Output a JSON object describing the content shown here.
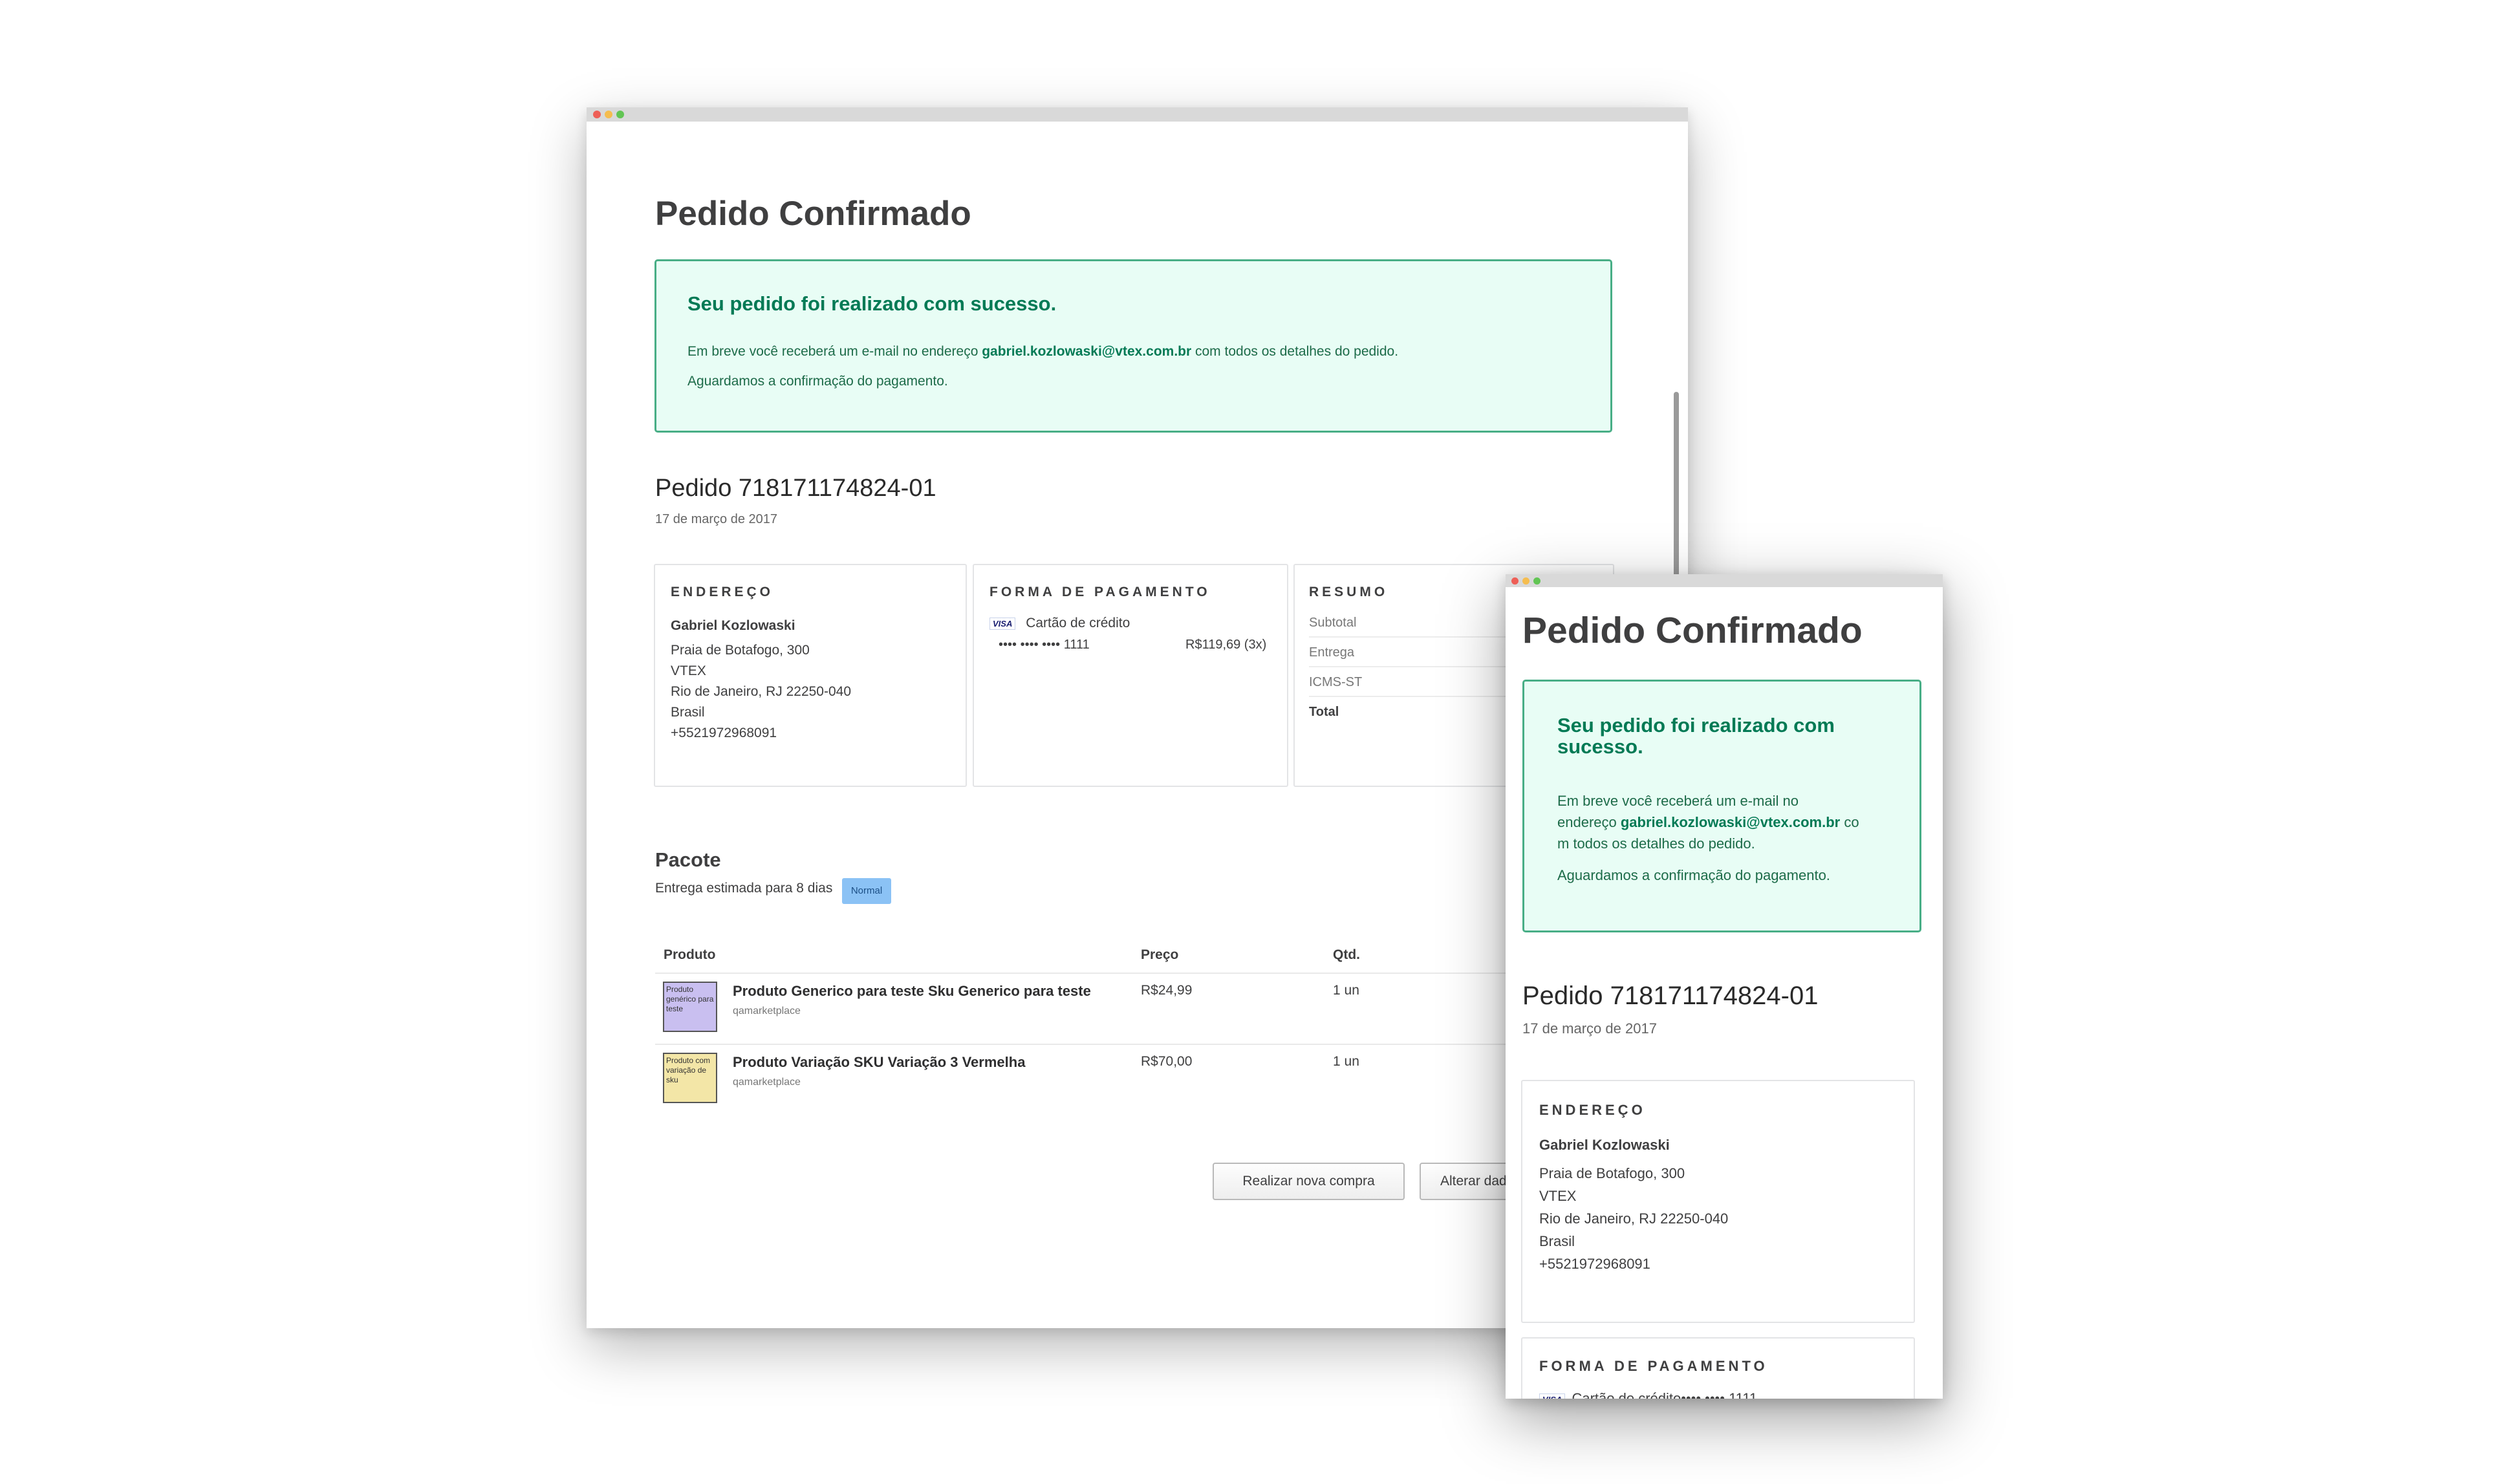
{
  "desktop": {
    "page_title": "Pedido Confirmado",
    "alert": {
      "title": "Seu pedido foi realizado com sucesso.",
      "line1_prefix": "Em breve você receberá um e-mail no endereço ",
      "email": "gabriel.kozlowaski@vtex.com.br",
      "line1_suffix": " com todos os detalhes do pedido.",
      "line2": "Aguardamos a confirmação do pagamento."
    },
    "order": {
      "title": "Pedido 718171174824-01",
      "date": "17 de março de 2017"
    },
    "address": {
      "label": "ENDEREÇO",
      "name": "Gabriel Kozlowaski",
      "street": "Praia de Botafogo, 300",
      "complement": "VTEX",
      "city": "Rio de Janeiro, RJ 22250-040",
      "country": "Brasil",
      "phone": "+5521972968091"
    },
    "payment": {
      "label": "FORMA DE PAGAMENTO",
      "card_brand": "VISA",
      "method": "Cartão de crédito",
      "card_number": "•••• •••• •••• 1111",
      "amount": "R$119,69 (3x)"
    },
    "summary": {
      "label": "RESUMO",
      "rows": [
        "Subtotal",
        "Entrega",
        "ICMS-ST",
        "Total"
      ]
    },
    "package": {
      "title": "Pacote",
      "delivery": "Entrega estimada para 8 dias",
      "badge": "Normal"
    },
    "table": {
      "headers": {
        "product": "Produto",
        "price": "Preço",
        "qty": "Qtd."
      },
      "rows": [
        {
          "thumb": "Produto genérico para teste",
          "name": "Produto Generico para teste Sku Generico para teste",
          "seller": "qamarketplace",
          "price": "R$24,99",
          "qty": "1 un"
        },
        {
          "thumb": "Produto com variação de sku",
          "name": "Produto Variação SKU Variação 3 Vermelha",
          "seller": "qamarketplace",
          "price": "R$70,00",
          "qty": "1 un"
        }
      ]
    },
    "buttons": {
      "new_purchase": "Realizar nova compra",
      "change_data": "Alterar dados"
    }
  },
  "mobile": {
    "page_title": "Pedido Confirmado",
    "alert": {
      "title_line1": "Seu pedido foi realizado com",
      "title_line2": "sucesso.",
      "line1": "Em breve você receberá um e-mail no",
      "line2_prefix": "endereço ",
      "email": "gabriel.kozlowaski@vtex.com.br",
      "line2_suffix": " co",
      "line3": "m todos os detalhes do pedido.",
      "line4": "Aguardamos a confirmação do pagamento."
    },
    "order": {
      "title": "Pedido 718171174824-01",
      "date": "17 de março de 2017"
    },
    "address": {
      "label": "ENDEREÇO",
      "name": "Gabriel Kozlowaski",
      "street": "Praia de Botafogo, 300",
      "complement": "VTEX",
      "city": "Rio de Janeiro, RJ 22250-040",
      "country": "Brasil",
      "phone": "+5521972968091"
    },
    "payment": {
      "label": "FORMA DE PAGAMENTO",
      "partial_line": "Cartão de crédito•••• •••• 1111"
    }
  },
  "colors": {
    "alert_bg": "#e8fdf5",
    "alert_border": "#48ae86",
    "alert_title": "#037a55",
    "badge_bg": "#8bc2f5",
    "heading": "#3f3f40"
  }
}
